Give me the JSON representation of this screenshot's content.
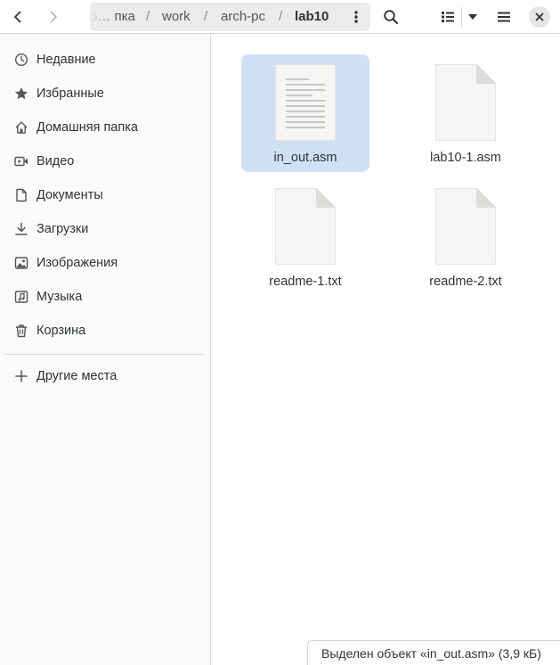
{
  "headerbar": {
    "path": [
      {
        "label": "о… пка"
      },
      {
        "label": "work"
      },
      {
        "label": "arch-pc"
      },
      {
        "label": "lab10"
      }
    ],
    "separator": "/"
  },
  "sidebar": {
    "items": [
      {
        "label": "Недавние",
        "icon": "clock-icon"
      },
      {
        "label": "Избранные",
        "icon": "star-icon"
      },
      {
        "label": "Домашняя папка",
        "icon": "home-icon"
      },
      {
        "label": "Видео",
        "icon": "video-icon"
      },
      {
        "label": "Документы",
        "icon": "document-icon"
      },
      {
        "label": "Загрузки",
        "icon": "download-icon"
      },
      {
        "label": "Изображения",
        "icon": "image-icon"
      },
      {
        "label": "Музыка",
        "icon": "music-icon"
      },
      {
        "label": "Корзина",
        "icon": "trash-icon"
      }
    ],
    "other_places": {
      "label": "Другие места",
      "icon": "plus-icon"
    }
  },
  "files": [
    {
      "name": "in_out.asm",
      "selected": true,
      "has_text_preview": true
    },
    {
      "name": "lab10-1.asm",
      "selected": false,
      "has_text_preview": false
    },
    {
      "name": "readme-1.txt",
      "selected": false,
      "has_text_preview": false
    },
    {
      "name": "readme-2.txt",
      "selected": false,
      "has_text_preview": false
    }
  ],
  "status": {
    "text": "Выделен объект «in_out.asm»  (3,9 кБ)"
  },
  "colors": {
    "selection": "#cfe0f6",
    "sidebar_bg": "#fafafa",
    "pathbar_bg": "#ebebeb"
  }
}
